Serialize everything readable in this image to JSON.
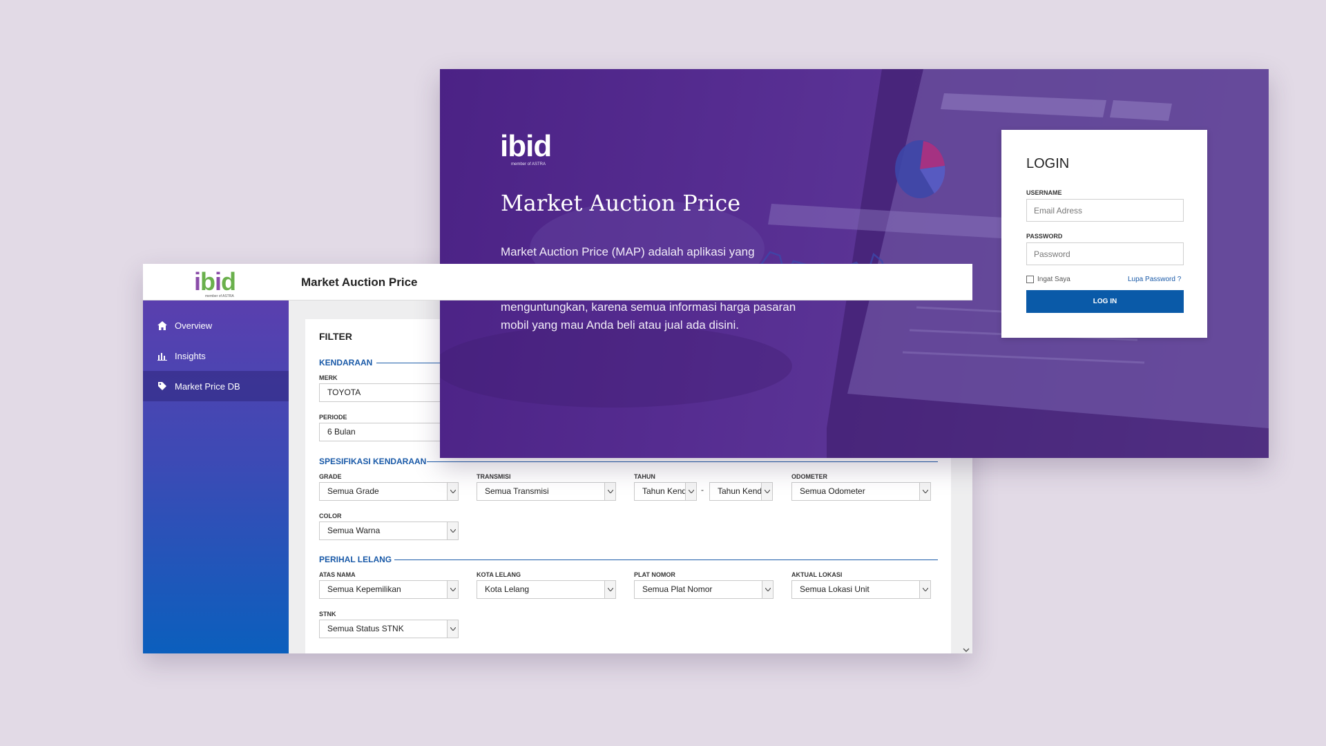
{
  "dashboard": {
    "logo": {
      "brand": "ibid",
      "tagline": "member of ASTRA"
    },
    "app_title": "Market Auction Price",
    "nav": [
      {
        "label": "Overview",
        "icon": "home-icon",
        "active": false
      },
      {
        "label": "Insights",
        "icon": "bar-chart-icon",
        "active": false
      },
      {
        "label": "Market Price DB",
        "icon": "tag-icon",
        "active": true
      }
    ],
    "filter_title": "FILTER",
    "sections": {
      "kendaraan": "KENDARAAN",
      "spesifikasi": "SPESIFIKASI KENDARAAN",
      "perihal": "PERIHAL LELANG"
    },
    "fields": {
      "merk": {
        "label": "MERK",
        "value": "TOYOTA"
      },
      "periode": {
        "label": "PERIODE",
        "value": "6 Bulan"
      },
      "grade": {
        "label": "GRADE",
        "value": "Semua Grade"
      },
      "transmisi": {
        "label": "TRANSMISI",
        "value": "Semua Transmisi"
      },
      "tahun": {
        "label": "TAHUN",
        "from": "Tahun Kendaraan",
        "to": "Tahun Kendaraan",
        "separator": "-"
      },
      "odometer": {
        "label": "ODOMETER",
        "value": "Semua Odometer"
      },
      "color": {
        "label": "COLOR",
        "value": "Semua Warna"
      },
      "atas_nama": {
        "label": "ATAS NAMA",
        "value": "Semua Kepemilikan"
      },
      "kota_lelang": {
        "label": "KOTA LELANG",
        "value": "Kota Lelang"
      },
      "plat_nomor": {
        "label": "PLAT NOMOR",
        "value": "Semua Plat Nomor"
      },
      "aktual_lokasi": {
        "label": "AKTUAL LOKASI",
        "value": "Semua Lokasi Unit"
      },
      "stnk": {
        "label": "STNK",
        "value": "Semua Status STNK"
      }
    }
  },
  "hero": {
    "logo": {
      "brand": "ibid",
      "tagline": "member of ASTRA"
    },
    "title": "Market Auction Price",
    "description": "Market Auction Price (MAP) adalah aplikasi yang menyediakan informasi harga pasaran mobil lelang terlengkap di Indonesia. Buatlah keputusan yang tepat dan menguntungkan, karena semua informasi harga pasaran mobil yang mau Anda beli atau jual ada disini."
  },
  "login": {
    "title": "LOGIN",
    "username_label": "USERNAME",
    "username_placeholder": "Email Adress",
    "password_label": "PASSWORD",
    "password_placeholder": "Password",
    "remember_label": "Ingat Saya",
    "forgot_label": "Lupa Password ?",
    "button_label": "LOG IN"
  },
  "colors": {
    "background": "#e2dae6",
    "hero_purple": "#562d91",
    "sidebar_top": "#5a3fae",
    "sidebar_bottom": "#0b5fbd",
    "primary_blue": "#0a5aa8",
    "logo_purple": "#8a4ca8",
    "logo_green": "#6ab04c"
  }
}
